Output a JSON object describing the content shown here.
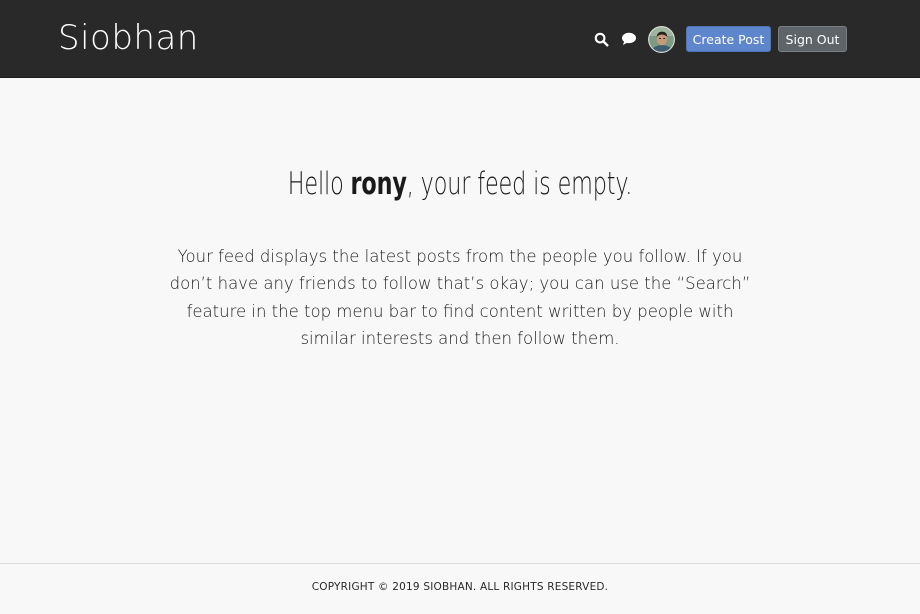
{
  "header": {
    "brand": "Siobhan",
    "create_post_label": "Create Post",
    "sign_out_label": "Sign Out",
    "search_icon": "search-icon",
    "chat_icon": "chat-icon",
    "avatar_icon": "user-avatar",
    "colors": {
      "bar_background": "#292929",
      "create_button": "#5e86cd",
      "sign_out_button": "#5f6468"
    }
  },
  "feed": {
    "greeting_prefix": "Hello ",
    "username": "rony",
    "greeting_suffix": ", your feed is empty.",
    "message": "Your feed displays the latest posts from the people you follow. If you don’t have any friends to follow that’s okay; you can use the “Search” feature in the top menu bar to find content written by people with similar interests and then follow them."
  },
  "footer": {
    "copyright": "COPYRIGHT © 2019 SIOBHAN. ALL RIGHTS RESERVED."
  }
}
